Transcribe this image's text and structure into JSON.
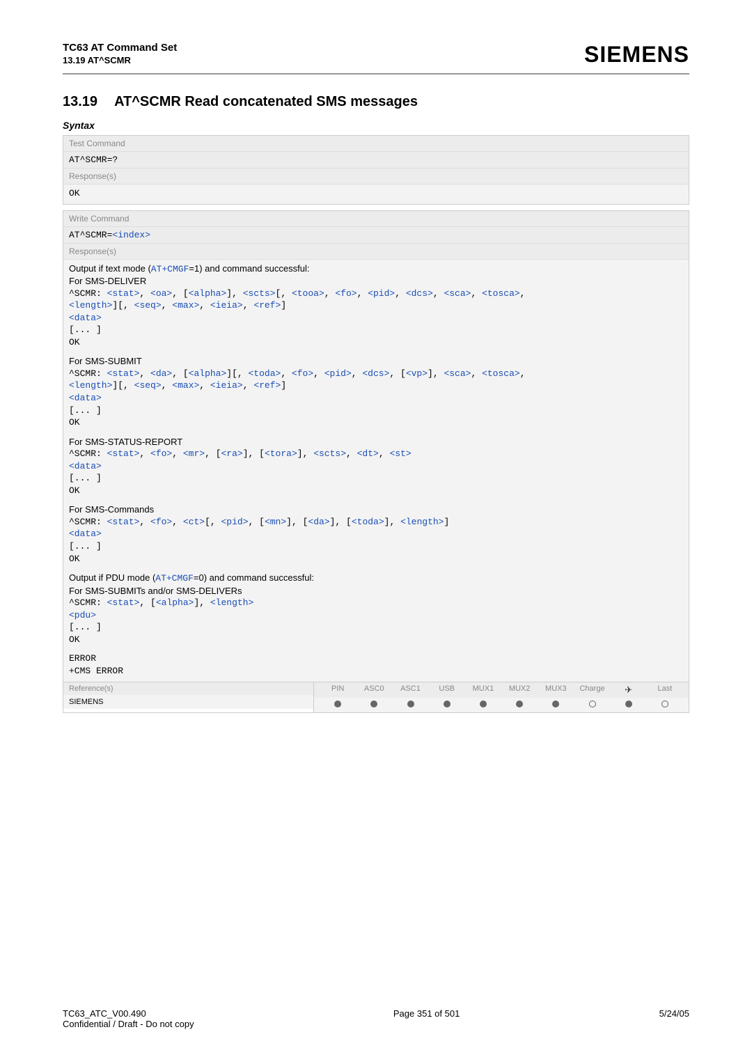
{
  "header": {
    "title": "TC63 AT Command Set",
    "subtitle": "13.19 AT^SCMR",
    "brand": "SIEMENS"
  },
  "section": {
    "number": "13.19",
    "title": "AT^SCMR   Read concatenated SMS messages",
    "syntax_label": "Syntax"
  },
  "test": {
    "label": "Test Command",
    "cmd": "AT^SCMR=?",
    "resp_label": "Response(s)",
    "resp": "OK"
  },
  "write": {
    "label": "Write Command",
    "cmd_prefix": "AT^SCMR=",
    "cmd_param": "<index>",
    "resp_label": "Response(s)",
    "intro_pre": "Output if text mode (",
    "intro_link": "AT+CMGF",
    "intro_post": "=1) and command successful:",
    "deliver_label": "For SMS-DELIVER",
    "submit_label": "For SMS-SUBMIT",
    "status_label": "For SMS-STATUS-REPORT",
    "commands_label": "For SMS-Commands",
    "pdu_intro_pre": "Output if PDU mode (",
    "pdu_intro_link": "AT+CMGF",
    "pdu_intro_post": "=0) and command successful:",
    "pdu_label": "For SMS-SUBMITs and/or SMS-DELIVERs",
    "scmr": "^SCMR: ",
    "tokens": {
      "stat": "<stat>",
      "oa": "<oa>",
      "alpha": "<alpha>",
      "scts": "<scts>",
      "tooa": "<tooa>",
      "fo": "<fo>",
      "pid": "<pid>",
      "dcs": "<dcs>",
      "sca": "<sca>",
      "tosca": "<tosca>",
      "length": "<length>",
      "seq": "<seq>",
      "max": "<max>",
      "ieia": "<ieia>",
      "ref": "<ref>",
      "data": "<data>",
      "da": "<da>",
      "toda": "<toda>",
      "vp": "<vp>",
      "mr": "<mr>",
      "ra": "<ra>",
      "tora": "<tora>",
      "dt": "<dt>",
      "st": "<st>",
      "ct": "<ct>",
      "mn": "<mn>",
      "pdu": "<pdu>"
    },
    "cont": "[... ]",
    "ok": "OK",
    "error": "ERROR",
    "cms": "+CMS ERROR"
  },
  "ref": {
    "label": "Reference(s)",
    "value": "SIEMENS",
    "cols": [
      "PIN",
      "ASC0",
      "ASC1",
      "USB",
      "MUX1",
      "MUX2",
      "MUX3",
      "Charge",
      "✈",
      "Last"
    ],
    "dots": [
      "f",
      "f",
      "f",
      "f",
      "f",
      "f",
      "f",
      "o",
      "f",
      "o"
    ]
  },
  "footer": {
    "left1": "TC63_ATC_V00.490",
    "left2": "Confidential / Draft - Do not copy",
    "center": "Page 351 of 501",
    "right": "5/24/05"
  }
}
